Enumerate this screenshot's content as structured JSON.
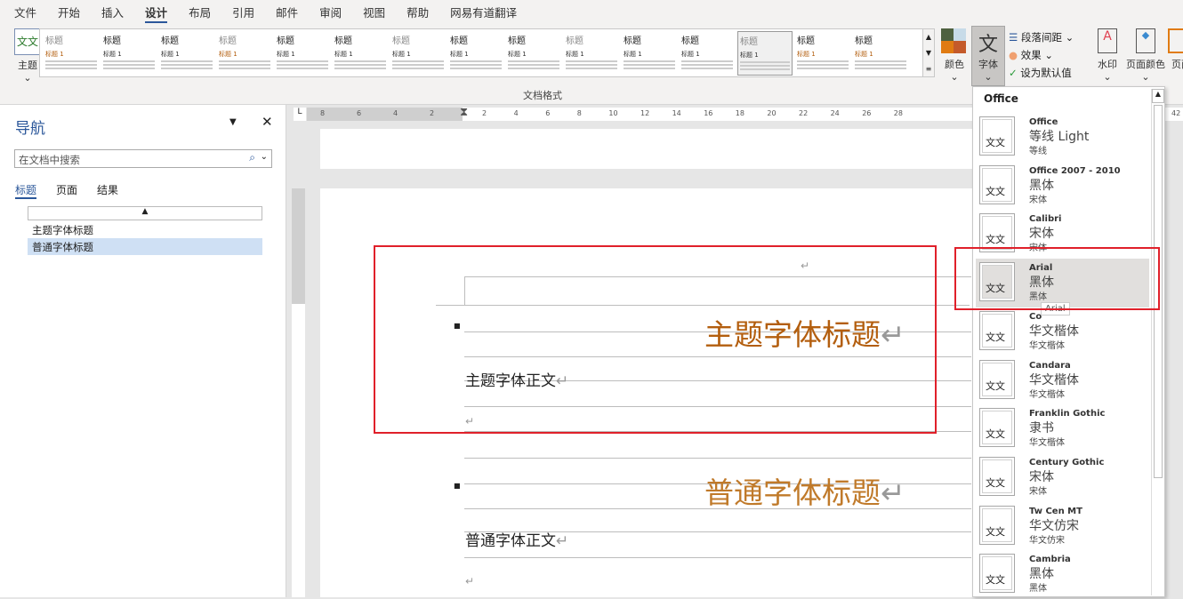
{
  "menu": [
    "文件",
    "开始",
    "插入",
    "设计",
    "布局",
    "引用",
    "邮件",
    "审阅",
    "视图",
    "帮助",
    "网易有道翻译"
  ],
  "menu_active": "设计",
  "ribbon": {
    "theme_label": "主题",
    "gallery_label": "文档格式",
    "gallery_item_title": "标题",
    "gallery_item_heading": "标题 1",
    "colors_label": "颜色",
    "fonts_label": "字体",
    "fonts_icon_char": "文",
    "paragraph_spacing": "段落间距",
    "effects": "效果",
    "set_default": "设为默认值",
    "watermark": "水印",
    "page_color": "页面颜色",
    "page_borders": "页面"
  },
  "nav": {
    "title": "导航",
    "search_placeholder": "在文档中搜索",
    "tabs": [
      "标题",
      "页面",
      "结果"
    ],
    "headings": [
      "主题字体标题",
      "普通字体标题"
    ]
  },
  "ruler": {
    "left": [
      "8",
      "6",
      "4",
      "2"
    ],
    "right": [
      "2",
      "4",
      "6",
      "8",
      "10",
      "12",
      "14",
      "16",
      "18",
      "20",
      "22",
      "24",
      "26",
      "28"
    ],
    "far": "42"
  },
  "doc": {
    "heading1": "主题字体标题",
    "body1": "主题字体正文",
    "heading2": "普通字体标题",
    "body2": "普通字体正文",
    "mark": "↵",
    "heading_color": "#b35e0e",
    "heading2_color": "#c07a2a"
  },
  "fonts_dropdown": {
    "section": "Office",
    "preview": "文文",
    "tooltip": "Arial",
    "items": [
      {
        "name": "Office",
        "heading": "等线 Light",
        "body": "等线"
      },
      {
        "name": "Office 2007 - 2010",
        "heading": "黑体",
        "body": "宋体"
      },
      {
        "name": "Calibri",
        "heading": "宋体",
        "body": "宋体"
      },
      {
        "name": "Arial",
        "heading": "黑体",
        "body": "黑体",
        "highlighted": true
      },
      {
        "name": "Co",
        "heading": "华文楷体",
        "body": "华文楷体"
      },
      {
        "name": "Candara",
        "heading": "华文楷体",
        "body": "华文楷体"
      },
      {
        "name": "Franklin Gothic",
        "heading": "隶书",
        "body": "华文楷体"
      },
      {
        "name": "Century Gothic",
        "heading": "宋体",
        "body": "宋体"
      },
      {
        "name": "Tw Cen MT",
        "heading": "华文仿宋",
        "body": "华文仿宋"
      },
      {
        "name": "Cambria",
        "heading": "黑体",
        "body": "黑体"
      }
    ]
  }
}
